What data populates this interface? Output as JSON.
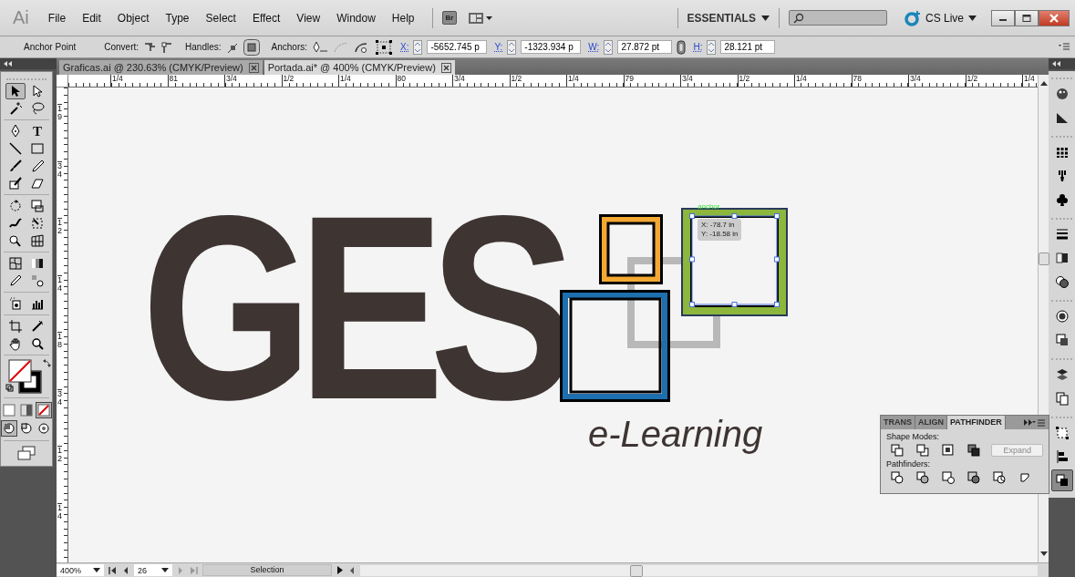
{
  "menu_bar": {
    "app_logo": "Ai",
    "items": [
      "File",
      "Edit",
      "Object",
      "Type",
      "Select",
      "Effect",
      "View",
      "Window",
      "Help"
    ],
    "bridge_button": "Br",
    "workspace": "ESSENTIALS",
    "cs_live": "CS Live"
  },
  "control_bar": {
    "tool_name": "Anchor Point",
    "convert_label": "Convert:",
    "handles_label": "Handles:",
    "anchors_label": "Anchors:",
    "fields": [
      {
        "label": "X:",
        "value": "-5652.745 p"
      },
      {
        "label": "Y:",
        "value": "-1323.934 p"
      },
      {
        "label": "W:",
        "value": "27.872 pt"
      },
      {
        "label": "H:",
        "value": "28.121 pt"
      }
    ]
  },
  "document_tabs": [
    {
      "label": "Graficas.ai @ 230.63% (CMYK/Preview)",
      "selected": false
    },
    {
      "label": "Portada.ai* @ 400% (CMYK/Preview)",
      "selected": true
    }
  ],
  "rulers": {
    "horizontal": [
      "1/4",
      "81",
      "3/4",
      "1/2",
      "1/4",
      "80",
      "3/4",
      "1/2",
      "1/4",
      "79",
      "3/4",
      "1/2",
      "1/4",
      "78",
      "3/4",
      "1/2",
      "1/4"
    ],
    "vertical": [
      "19",
      "34",
      "12",
      "14",
      "18",
      "34",
      "12",
      "14"
    ]
  },
  "tools": [
    {
      "selected": true
    },
    {
      "selected": false
    },
    {
      "selected": false
    },
    {
      "selected": false
    },
    {
      "selected": false
    },
    {
      "selected": false,
      "glyph": "T"
    },
    {
      "selected": false
    },
    {
      "selected": false
    },
    {
      "selected": false
    },
    {
      "selected": false
    },
    {
      "selected": false
    },
    {
      "selected": false
    },
    {
      "selected": false
    },
    {
      "selected": false
    },
    {
      "selected": false
    },
    {
      "selected": false
    },
    {
      "selected": false
    },
    {
      "selected": false
    },
    {
      "selected": false
    },
    {
      "selected": false
    },
    {
      "selected": false
    },
    {
      "selected": false
    },
    {
      "selected": false
    },
    {
      "selected": false
    },
    {
      "selected": false
    },
    {
      "selected": false
    },
    {
      "selected": false
    },
    {
      "selected": false
    }
  ],
  "color_modes": [
    {
      "selected": false
    },
    {
      "selected": false
    },
    {
      "selected": true
    }
  ],
  "draw_modes": [
    {
      "selected": true
    },
    {
      "selected": false
    },
    {
      "selected": false
    }
  ],
  "artwork": {
    "logo_text": "GES",
    "tagline": "e-Learning",
    "anchor_hint": "anchor",
    "cursor_readout": [
      "X: -78.7 in",
      "Y: -18.58 in"
    ]
  },
  "pathfinder_panel": {
    "tabs": [
      {
        "label": "TRANS",
        "selected": false
      },
      {
        "label": "ALIGN",
        "selected": false
      },
      {
        "label": "PATHFINDER",
        "selected": true
      }
    ],
    "shape_modes_label": "Shape Modes:",
    "expand_button": {
      "label": "Expand",
      "disabled": true
    },
    "pathfinders_label": "Pathfinders:"
  },
  "dock": [
    {
      "selected": false
    },
    {
      "selected": false
    },
    {
      "selected": false
    },
    {
      "selected": false
    },
    {
      "selected": false
    },
    {
      "selected": false
    },
    {
      "selected": false
    },
    {
      "selected": false
    },
    {
      "selected": false
    },
    {
      "selected": false
    },
    {
      "selected": false
    },
    {
      "selected": false
    },
    {
      "selected": false
    },
    {
      "selected": false
    },
    {
      "selected": true
    }
  ],
  "status_bar": {
    "zoom": "400%",
    "artboard": "26",
    "current_tool": "Selection"
  }
}
